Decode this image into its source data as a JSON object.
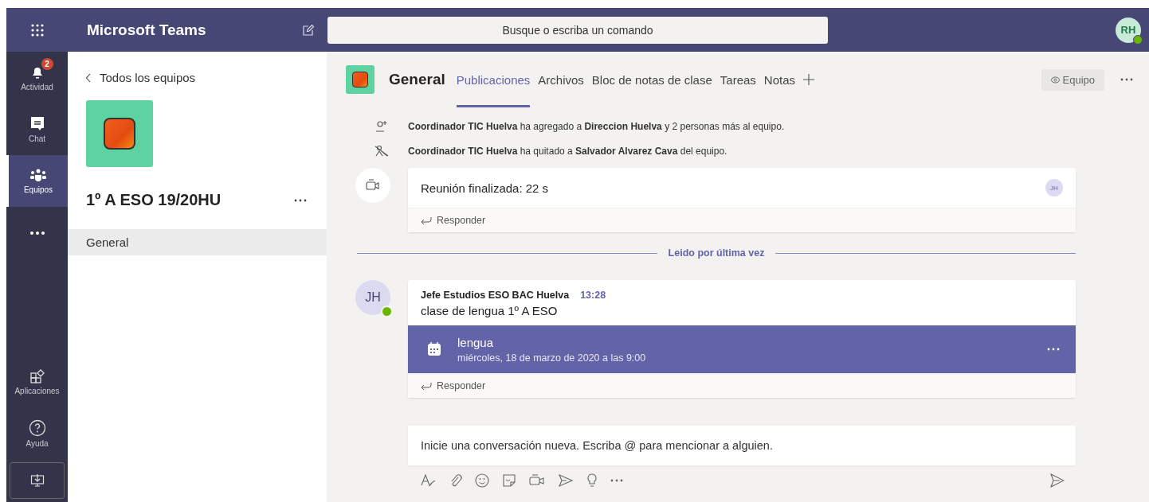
{
  "app": {
    "title": "Microsoft Teams"
  },
  "search": {
    "placeholder": "Busque o escriba un comando"
  },
  "user": {
    "initials": "RH",
    "online": true
  },
  "rail": {
    "items": [
      {
        "kind": "bell",
        "label": "Actividad",
        "badge": "2",
        "selected": false
      },
      {
        "kind": "chat",
        "label": "Chat",
        "selected": false
      },
      {
        "kind": "teams",
        "label": "Equipos",
        "selected": true
      },
      {
        "kind": "more",
        "selected": false
      }
    ],
    "bottom": [
      {
        "kind": "apps",
        "label": "Aplicaciones"
      },
      {
        "kind": "help",
        "label": "Ayuda"
      },
      {
        "kind": "download"
      }
    ]
  },
  "team": {
    "back": "Todos los equipos",
    "name": "1º A ESO 19/20HU",
    "channels": [
      {
        "name": "General",
        "selected": true
      }
    ]
  },
  "channel": {
    "name": "General",
    "tabs": [
      {
        "label": "Publicaciones",
        "selected": true
      },
      {
        "label": "Archivos",
        "selected": false
      },
      {
        "label": "Bloc de notas de clase",
        "selected": false
      },
      {
        "label": "Tareas",
        "selected": false
      },
      {
        "label": "Notas",
        "selected": false
      }
    ],
    "team_button": "Equipo"
  },
  "feed": [
    {
      "kind": "added",
      "text": "**Coordinador TIC Huelva** ha agregado a **Direccion Huelva** y 2 personas más al equipo."
    },
    {
      "kind": "removed",
      "text": "**Coordinador TIC Huelva** ha quitado a **Salvador Alvarez Cava** del equipo."
    },
    {
      "kind": "meeting",
      "title": "Reunión finalizada: 22 s",
      "avatar": "JH",
      "reply": "Responder"
    },
    {
      "kind": "divider",
      "text": "Leido por última vez"
    },
    {
      "kind": "post",
      "avatar": "JH",
      "online": true,
      "author": "Jefe Estudios ESO BAC Huelva",
      "time": "13:28",
      "text": "clase de lengua 1º A ESO",
      "event": {
        "title": "lengua",
        "date": "miércoles, 18 de marzo de 2020 a las 9:00"
      },
      "reply": "Responder"
    }
  ],
  "compose": {
    "placeholder": "Inicie una conversación nueva. Escriba @ para mencionar a alguien."
  }
}
